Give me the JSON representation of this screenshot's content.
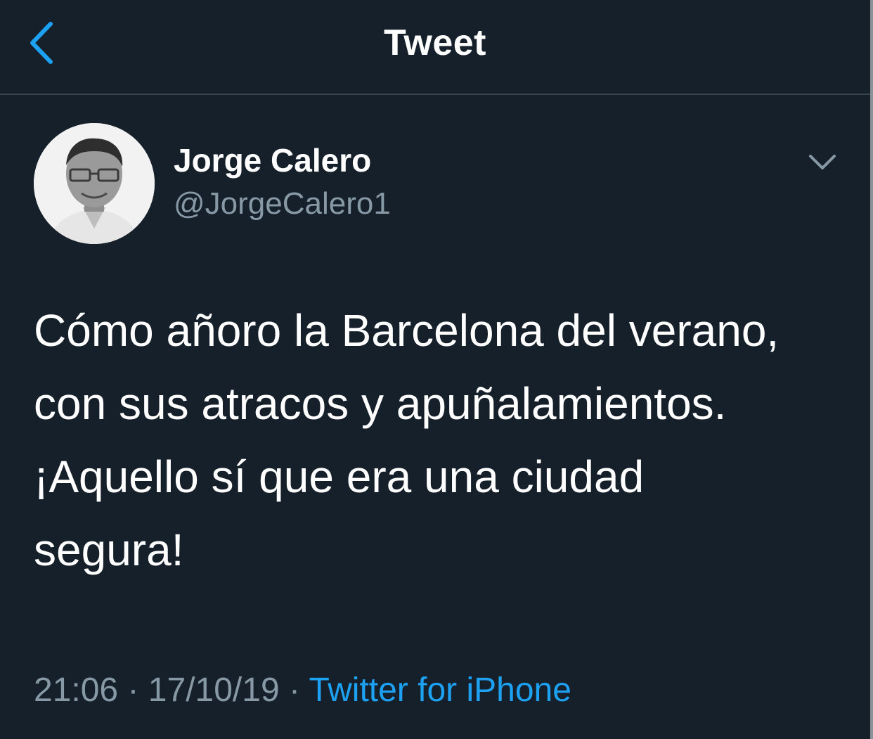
{
  "header": {
    "back_icon": "chevron-left-icon",
    "title": "Tweet"
  },
  "tweet": {
    "author": {
      "display_name": "Jorge Calero",
      "handle": "@JorgeCalero1",
      "avatar": "profile-photo"
    },
    "menu_icon": "chevron-down-icon",
    "text_lines": [
      "Cómo añoro la Barcelona del verano,",
      "con sus atracos y apuñalamientos.",
      "¡Aquello sí que era una ciudad",
      "segura!"
    ],
    "time": "21:06",
    "separator": "·",
    "date": "17/10/19",
    "source": "Twitter for iPhone"
  },
  "colors": {
    "background": "#15202b",
    "accent": "#1da1f2",
    "secondary_text": "#8899a6",
    "divider": "#38444d"
  }
}
